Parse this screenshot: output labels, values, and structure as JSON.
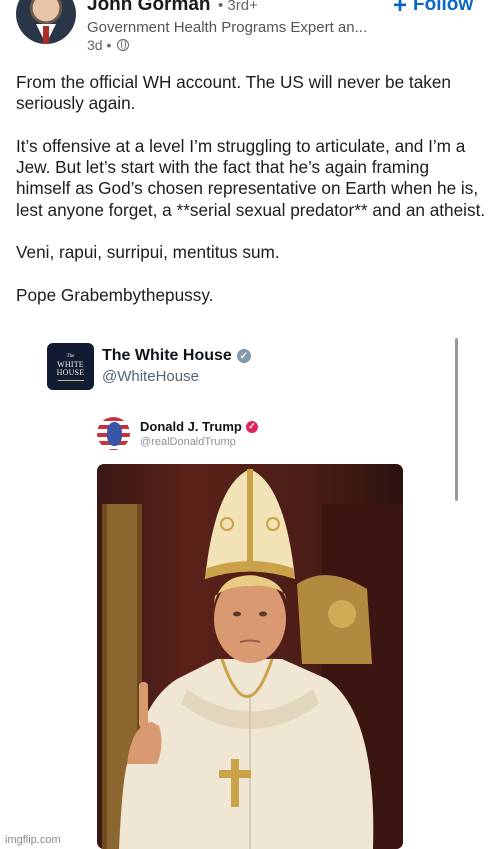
{
  "post": {
    "author": {
      "name": "John Gorman",
      "degree": "• 3rd+",
      "headline": "Government Health Programs Expert an...",
      "time": "3d •"
    },
    "follow_label": "Follow",
    "paragraphs": [
      "From the official WH account. The US will never be taken seriously again.",
      "It’s offensive at a level I’m struggling to articulate, and I’m a Jew. But let’s start with the fact that he’s again framing himself as God’s chosen representative on Earth when he is, lest anyone forget, a **serial sexual predator** and an atheist.",
      "Veni, rapui, surripui, mentitus sum.",
      "Pope Grabembythepussy."
    ]
  },
  "embed": {
    "account_name": "The White House",
    "account_handle": "@WhiteHouse",
    "logo_small": "The",
    "logo_line1": "WHITE",
    "logo_line2": "HOUSE",
    "inner_name": "Donald J. Trump",
    "inner_handle": "@realDonaldTrump"
  },
  "watermark": "imgflip.com",
  "colors": {
    "link_blue": "#0a66c2",
    "verified_grey": "#829aab",
    "verified_red": "#e0245e"
  },
  "icons": {
    "follow": "plus-icon",
    "visibility": "globe-icon",
    "verified": "checkmark-badge-icon"
  }
}
